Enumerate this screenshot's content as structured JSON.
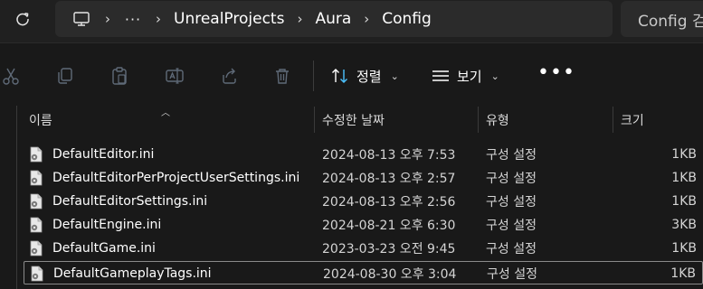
{
  "address_bar": {
    "refresh_icon": "refresh-icon",
    "computer_icon": "computer-icon",
    "separator": "›",
    "overflow": "···",
    "breadcrumbs": [
      "UnrealProjects",
      "Aura",
      "Config"
    ]
  },
  "search": {
    "text": "Config 검"
  },
  "toolbar": {
    "icons": [
      "cut-icon",
      "copy-icon",
      "paste-icon",
      "rename-icon",
      "share-icon",
      "delete-icon"
    ],
    "sort_label": "정렬",
    "view_label": "보기",
    "more_label": "•••"
  },
  "columns": {
    "name": "이름",
    "date": "수정한 날짜",
    "type": "유형",
    "size": "크기"
  },
  "files": [
    {
      "name": "DefaultEditor.ini",
      "date": "2024-08-13 오후 7:53",
      "type": "구성 설정",
      "size": "1KB"
    },
    {
      "name": "DefaultEditorPerProjectUserSettings.ini",
      "date": "2024-08-13 오후 2:57",
      "type": "구성 설정",
      "size": "1KB"
    },
    {
      "name": "DefaultEditorSettings.ini",
      "date": "2024-08-13 오후 2:56",
      "type": "구성 설정",
      "size": "1KB"
    },
    {
      "name": "DefaultEngine.ini",
      "date": "2024-08-21 오후 6:30",
      "type": "구성 설정",
      "size": "3KB"
    },
    {
      "name": "DefaultGame.ini",
      "date": "2023-03-23 오전 9:45",
      "type": "구성 설정",
      "size": "1KB"
    },
    {
      "name": "DefaultGameplayTags.ini",
      "date": "2024-08-30 오후 3:04",
      "type": "구성 설정",
      "size": "1KB"
    }
  ],
  "colors": {
    "background": "#191919",
    "address_bar_bg": "#202020",
    "field_bg": "#2b2b2b",
    "accent": "#4cc2ff",
    "selection_border": "#8a8a8a"
  }
}
